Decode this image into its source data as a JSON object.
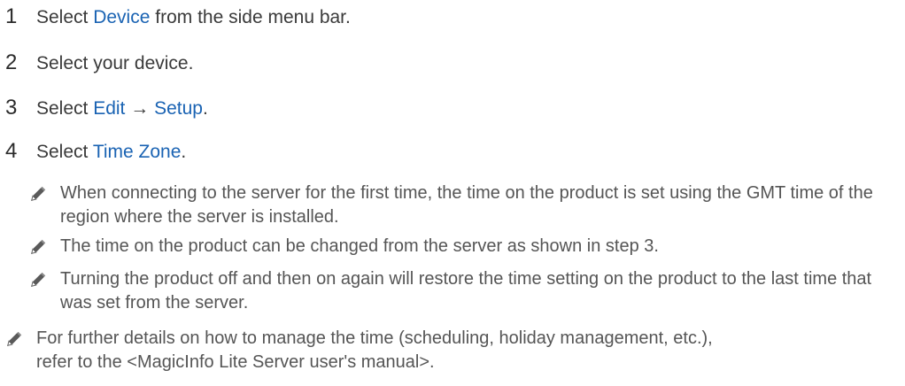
{
  "steps": [
    {
      "number": "1",
      "pre": "Select ",
      "link": "Device",
      "post": " from the side menu bar."
    },
    {
      "number": "2",
      "text": "Select your device."
    },
    {
      "number": "3",
      "pre": "Select ",
      "link1": "Edit",
      "arrow": " → ",
      "link2": "Setup",
      "post": "."
    },
    {
      "number": "4",
      "pre": "Select ",
      "link": "Time Zone",
      "post": "."
    }
  ],
  "sub_notes": [
    "When connecting to the server for the first time, the time on the product is set using the GMT time of the region where the server is installed.",
    "The time on the product can be changed from the server as shown in step 3.",
    "Turning the product off and then on again will restore the time setting on the product to the last time that was set from the server."
  ],
  "main_note": "For further details on how to manage the time (scheduling, holiday management, etc.), refer to the <MagicInfo Lite Server user's manual>.",
  "colors": {
    "link": "#1a63b3",
    "text": "#3a3a3a",
    "note": "#555555"
  },
  "icons": {
    "note": "pencil-icon"
  }
}
